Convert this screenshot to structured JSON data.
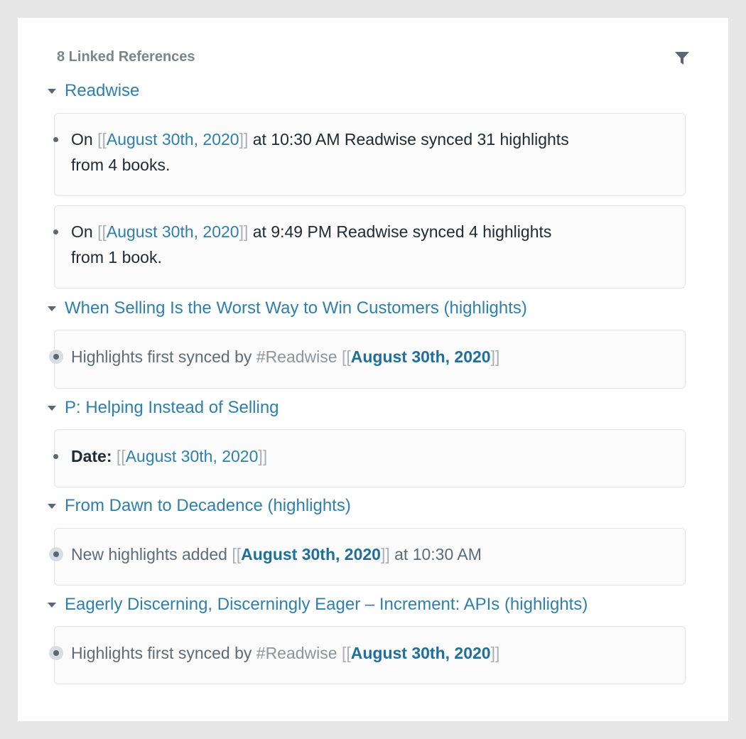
{
  "header": {
    "title": "8 Linked References",
    "filter_icon": "filter-icon"
  },
  "open_bracket": "[[",
  "close_bracket": "]]",
  "groups": [
    {
      "title": "Readwise",
      "blocks": [
        {
          "prefix": "On",
          "link": "August 30th, 2020",
          "suffix_line1": "at 10:30 AM Readwise synced 31 highlights",
          "line2": "from 4 books."
        },
        {
          "prefix": "On",
          "link": "August 30th, 2020",
          "suffix_line1": "at 9:49 PM Readwise synced 4 highlights",
          "line2": "from 1 book."
        }
      ]
    },
    {
      "title": "When Selling Is the Worst Way to Win Customers (highlights)",
      "blocks": [
        {
          "text": "Highlights first synced by",
          "tag": "#Readwise",
          "link": "August 30th, 2020"
        }
      ]
    },
    {
      "title": "P: Helping Instead of Selling",
      "blocks": [
        {
          "label": "Date:",
          "link": "August 30th, 2020"
        }
      ]
    },
    {
      "title": "From Dawn to Decadence (highlights)",
      "blocks": [
        {
          "text": "New highlights added",
          "link": "August 30th, 2020",
          "suffix": "at 10:30 AM"
        }
      ]
    },
    {
      "title": "Eagerly Discerning, Discerningly Eager – Increment: APIs (highlights)",
      "blocks": [
        {
          "text": "Highlights first synced by",
          "tag": "#Readwise",
          "link": "August 30th, 2020"
        }
      ]
    }
  ],
  "colors": {
    "link": "#2f7fac",
    "link_bold": "#1f6f9c",
    "bracket": "#a9b0b6",
    "header": "#7e858a",
    "card_border": "#e1e4e7"
  }
}
